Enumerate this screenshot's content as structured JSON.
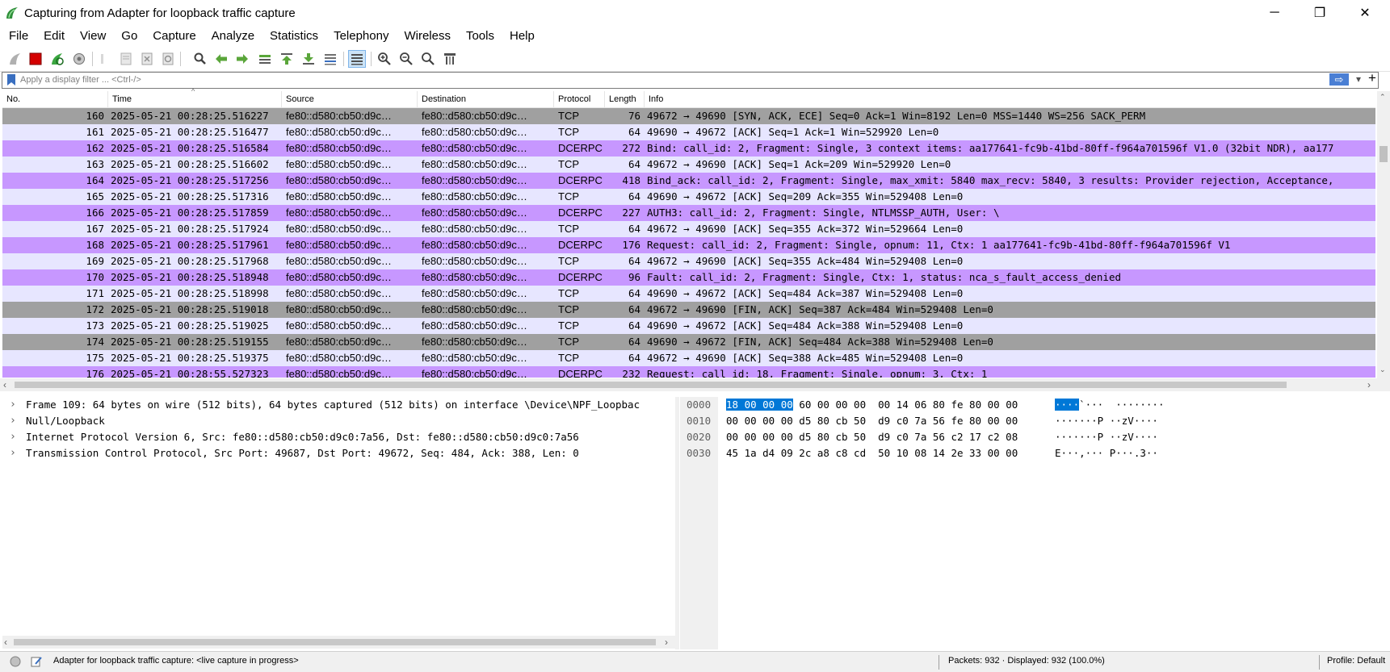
{
  "window": {
    "title": "Capturing from Adapter for loopback traffic capture",
    "minimize_glyph": "─",
    "maximize_glyph": "❐",
    "close_glyph": "✕"
  },
  "menu": [
    "File",
    "Edit",
    "View",
    "Go",
    "Capture",
    "Analyze",
    "Statistics",
    "Telephony",
    "Wireless",
    "Tools",
    "Help"
  ],
  "toolbar_icons": [
    "shark-fin-start-icon",
    "stop-capture-icon",
    "restart-capture-icon",
    "capture-options-icon",
    "open-file-icon",
    "save-file-icon",
    "close-file-icon",
    "reload-file-icon",
    "find-packet-icon",
    "go-back-icon",
    "go-forward-icon",
    "go-to-packet-icon",
    "first-packet-icon",
    "last-packet-icon",
    "autoscroll-icon",
    "colorize-icon",
    "zoom-in-icon",
    "zoom-out-icon",
    "normal-size-icon",
    "resize-columns-icon"
  ],
  "filter": {
    "placeholder": "Apply a display filter ... <Ctrl-/>",
    "apply_arrow": "⇨",
    "dropdown": "▾",
    "add_button": "+"
  },
  "columns": {
    "no": "No.",
    "time": "Time",
    "source": "Source",
    "destination": "Destination",
    "protocol": "Protocol",
    "length": "Length",
    "info": "Info"
  },
  "colors": {
    "tcp_flag_bg": "#a0a0a0",
    "tcp_bg": "#e7e6ff",
    "dcerpc_bg": "#c797ff",
    "selection": "#0078d7"
  },
  "packets": [
    {
      "no": "160",
      "time": "2025-05-21 00:28:25.516227",
      "src": "fe80::d580:cb50:d9c…",
      "dst": "fe80::d580:cb50:d9c…",
      "proto": "TCP",
      "len": "76",
      "info": "49672 → 49690 [SYN, ACK, ECE] Seq=0 Ack=1 Win=8192 Len=0 MSS=1440 WS=256 SACK_PERM",
      "bg": "#a0a0a0"
    },
    {
      "no": "161",
      "time": "2025-05-21 00:28:25.516477",
      "src": "fe80::d580:cb50:d9c…",
      "dst": "fe80::d580:cb50:d9c…",
      "proto": "TCP",
      "len": "64",
      "info": "49690 → 49672 [ACK] Seq=1 Ack=1 Win=529920 Len=0",
      "bg": "#e7e6ff"
    },
    {
      "no": "162",
      "time": "2025-05-21 00:28:25.516584",
      "src": "fe80::d580:cb50:d9c…",
      "dst": "fe80::d580:cb50:d9c…",
      "proto": "DCERPC",
      "len": "272",
      "info": "Bind: call_id: 2, Fragment: Single, 3 context items: aa177641-fc9b-41bd-80ff-f964a701596f V1.0 (32bit NDR), aa177",
      "bg": "#c797ff"
    },
    {
      "no": "163",
      "time": "2025-05-21 00:28:25.516602",
      "src": "fe80::d580:cb50:d9c…",
      "dst": "fe80::d580:cb50:d9c…",
      "proto": "TCP",
      "len": "64",
      "info": "49672 → 49690 [ACK] Seq=1 Ack=209 Win=529920 Len=0",
      "bg": "#e7e6ff"
    },
    {
      "no": "164",
      "time": "2025-05-21 00:28:25.517256",
      "src": "fe80::d580:cb50:d9c…",
      "dst": "fe80::d580:cb50:d9c…",
      "proto": "DCERPC",
      "len": "418",
      "info": "Bind_ack: call_id: 2, Fragment: Single, max_xmit: 5840 max_recv: 5840, 3 results: Provider rejection, Acceptance,",
      "bg": "#c797ff"
    },
    {
      "no": "165",
      "time": "2025-05-21 00:28:25.517316",
      "src": "fe80::d580:cb50:d9c…",
      "dst": "fe80::d580:cb50:d9c…",
      "proto": "TCP",
      "len": "64",
      "info": "49690 → 49672 [ACK] Seq=209 Ack=355 Win=529408 Len=0",
      "bg": "#e7e6ff"
    },
    {
      "no": "166",
      "time": "2025-05-21 00:28:25.517859",
      "src": "fe80::d580:cb50:d9c…",
      "dst": "fe80::d580:cb50:d9c…",
      "proto": "DCERPC",
      "len": "227",
      "info": "AUTH3: call_id: 2, Fragment: Single, NTLMSSP_AUTH, User: \\",
      "bg": "#c797ff"
    },
    {
      "no": "167",
      "time": "2025-05-21 00:28:25.517924",
      "src": "fe80::d580:cb50:d9c…",
      "dst": "fe80::d580:cb50:d9c…",
      "proto": "TCP",
      "len": "64",
      "info": "49672 → 49690 [ACK] Seq=355 Ack=372 Win=529664 Len=0",
      "bg": "#e7e6ff"
    },
    {
      "no": "168",
      "time": "2025-05-21 00:28:25.517961",
      "src": "fe80::d580:cb50:d9c…",
      "dst": "fe80::d580:cb50:d9c…",
      "proto": "DCERPC",
      "len": "176",
      "info": "Request: call_id: 2, Fragment: Single, opnum: 11, Ctx: 1 aa177641-fc9b-41bd-80ff-f964a701596f V1",
      "bg": "#c797ff"
    },
    {
      "no": "169",
      "time": "2025-05-21 00:28:25.517968",
      "src": "fe80::d580:cb50:d9c…",
      "dst": "fe80::d580:cb50:d9c…",
      "proto": "TCP",
      "len": "64",
      "info": "49672 → 49690 [ACK] Seq=355 Ack=484 Win=529408 Len=0",
      "bg": "#e7e6ff"
    },
    {
      "no": "170",
      "time": "2025-05-21 00:28:25.518948",
      "src": "fe80::d580:cb50:d9c…",
      "dst": "fe80::d580:cb50:d9c…",
      "proto": "DCERPC",
      "len": "96",
      "info": "Fault: call_id: 2, Fragment: Single, Ctx: 1, status: nca_s_fault_access_denied",
      "bg": "#c797ff"
    },
    {
      "no": "171",
      "time": "2025-05-21 00:28:25.518998",
      "src": "fe80::d580:cb50:d9c…",
      "dst": "fe80::d580:cb50:d9c…",
      "proto": "TCP",
      "len": "64",
      "info": "49690 → 49672 [ACK] Seq=484 Ack=387 Win=529408 Len=0",
      "bg": "#e7e6ff"
    },
    {
      "no": "172",
      "time": "2025-05-21 00:28:25.519018",
      "src": "fe80::d580:cb50:d9c…",
      "dst": "fe80::d580:cb50:d9c…",
      "proto": "TCP",
      "len": "64",
      "info": "49672 → 49690 [FIN, ACK] Seq=387 Ack=484 Win=529408 Len=0",
      "bg": "#a0a0a0"
    },
    {
      "no": "173",
      "time": "2025-05-21 00:28:25.519025",
      "src": "fe80::d580:cb50:d9c…",
      "dst": "fe80::d580:cb50:d9c…",
      "proto": "TCP",
      "len": "64",
      "info": "49690 → 49672 [ACK] Seq=484 Ack=388 Win=529408 Len=0",
      "bg": "#e7e6ff"
    },
    {
      "no": "174",
      "time": "2025-05-21 00:28:25.519155",
      "src": "fe80::d580:cb50:d9c…",
      "dst": "fe80::d580:cb50:d9c…",
      "proto": "TCP",
      "len": "64",
      "info": "49690 → 49672 [FIN, ACK] Seq=484 Ack=388 Win=529408 Len=0",
      "bg": "#a0a0a0"
    },
    {
      "no": "175",
      "time": "2025-05-21 00:28:25.519375",
      "src": "fe80::d580:cb50:d9c…",
      "dst": "fe80::d580:cb50:d9c…",
      "proto": "TCP",
      "len": "64",
      "info": "49672 → 49690 [ACK] Seq=388 Ack=485 Win=529408 Len=0",
      "bg": "#e7e6ff"
    },
    {
      "no": "176",
      "time": "2025-05-21 00:28:55.527323",
      "src": "fe80::d580:cb50:d9c…",
      "dst": "fe80::d580:cb50:d9c…",
      "proto": "DCERPC",
      "len": "232",
      "info": "Request: call_id: 18, Fragment: Single, opnum: 3, Ctx: 1",
      "bg": "#c797ff"
    }
  ],
  "details": [
    "Frame 109: 64 bytes on wire (512 bits), 64 bytes captured (512 bits) on interface \\Device\\NPF_Loopbac",
    "Null/Loopback",
    "Internet Protocol Version 6, Src: fe80::d580:cb50:d9c0:7a56, Dst: fe80::d580:cb50:d9c0:7a56",
    "Transmission Control Protocol, Src Port: 49687, Dst Port: 49672, Seq: 484, Ack: 388, Len: 0"
  ],
  "details_chevron": "›",
  "bytes": [
    {
      "offset": "0000",
      "sel_hex": "18 00 00 00",
      "hex": " 60 00 00 00  00 14 06 80 fe 80 00 00",
      "sel_ascii": "····",
      "ascii": "`···  ········"
    },
    {
      "offset": "0010",
      "sel_hex": "",
      "hex": "00 00 00 00 d5 80 cb 50  d9 c0 7a 56 fe 80 00 00",
      "sel_ascii": "",
      "ascii": "·······P ··zV····"
    },
    {
      "offset": "0020",
      "sel_hex": "",
      "hex": "00 00 00 00 d5 80 cb 50  d9 c0 7a 56 c2 17 c2 08",
      "sel_ascii": "",
      "ascii": "·······P ··zV····"
    },
    {
      "offset": "0030",
      "sel_hex": "",
      "hex": "45 1a d4 09 2c a8 c8 cd  50 10 08 14 2e 33 00 00",
      "sel_ascii": "",
      "ascii": "E···,··· P···.3··"
    }
  ],
  "status": {
    "capture_text": "Adapter for loopback traffic capture: <live capture in progress>",
    "packets_text": "Packets: 932 · Displayed: 932 (100.0%)",
    "profile_text": "Profile: Default"
  }
}
